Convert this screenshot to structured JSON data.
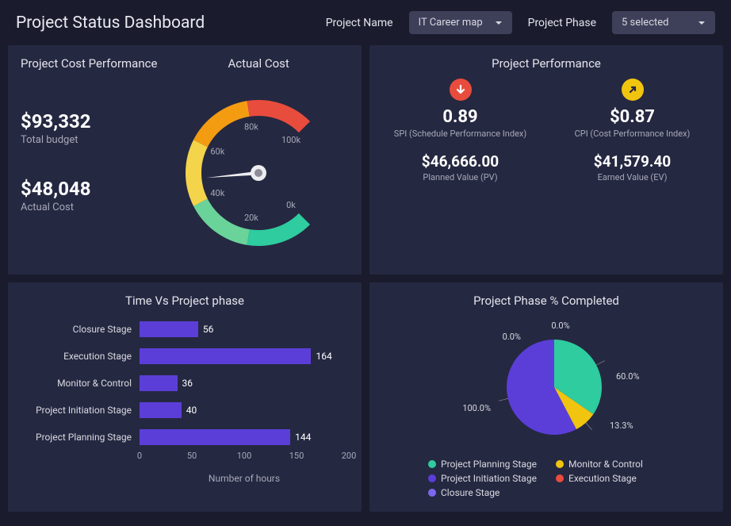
{
  "header": {
    "title": "Project Status Dashboard",
    "filter1_label": "Project Name",
    "filter1_value": "IT Career map",
    "filter2_label": "Project Phase",
    "filter2_value": "5 selected"
  },
  "cost": {
    "left_title": "Project Cost Performance",
    "gauge_title": "Actual Cost",
    "total_budget_value": "$93,332",
    "total_budget_label": "Total budget",
    "actual_cost_value": "$48,048",
    "actual_cost_label": "Actual Cost"
  },
  "performance": {
    "title": "Project Performance",
    "spi_value": "0.89",
    "spi_label": "SPI (Schedule Performance Index)",
    "cpi_value": "$0.87",
    "cpi_label": "CPI (Cost Performance Index)",
    "pv_value": "$46,666.00",
    "pv_label": "Planned Value (PV)",
    "ev_value": "$41,579.40",
    "ev_label": "Earned Value (EV)"
  },
  "bar": {
    "title": "Time Vs Project phase",
    "x_title": "Number of hours"
  },
  "pie": {
    "title": "Project Phase % Completed"
  },
  "chart_data": [
    {
      "type": "gauge",
      "title": "Actual Cost",
      "value": 48048,
      "min": 0,
      "max": 100000,
      "ticks": [
        "0k",
        "20k",
        "40k",
        "60k",
        "80k",
        "100k"
      ],
      "bands": [
        {
          "from": 0,
          "to": 20000,
          "color": "#2ecc9f"
        },
        {
          "from": 20000,
          "to": 40000,
          "color": "#6ad39a"
        },
        {
          "from": 40000,
          "to": 60000,
          "color": "#f3d44b"
        },
        {
          "from": 60000,
          "to": 80000,
          "color": "#f39c12"
        },
        {
          "from": 80000,
          "to": 100000,
          "color": "#e84c3d"
        }
      ]
    },
    {
      "type": "bar",
      "orientation": "horizontal",
      "title": "Time Vs Project phase",
      "xlabel": "Number of hours",
      "ylabel": "",
      "xlim": [
        0,
        200
      ],
      "xticks": [
        0,
        50,
        100,
        150,
        200
      ],
      "categories": [
        "Closure Stage",
        "Execution Stage",
        "Monitor & Control",
        "Project Initiation Stage",
        "Project Planning Stage"
      ],
      "values": [
        56,
        164,
        36,
        40,
        144
      ],
      "color": "#5b3ed8"
    },
    {
      "type": "pie",
      "title": "Project Phase % Completed",
      "series": [
        {
          "name": "Project Planning Stage",
          "value": 60.0,
          "color": "#2ecc9f",
          "label": "60.0%"
        },
        {
          "name": "Monitor & Control",
          "value": 13.3,
          "color": "#f1c40f",
          "label": "13.3%"
        },
        {
          "name": "Project Initiation Stage",
          "value": 100.0,
          "color": "#5b3ed8",
          "label": "100.0%"
        },
        {
          "name": "Execution Stage",
          "value": 0.0,
          "color": "#e84c3d",
          "label": "0.0%"
        },
        {
          "name": "Closure Stage",
          "value": 0.0,
          "color": "#7b68ee",
          "label": "0.0%"
        }
      ]
    }
  ]
}
